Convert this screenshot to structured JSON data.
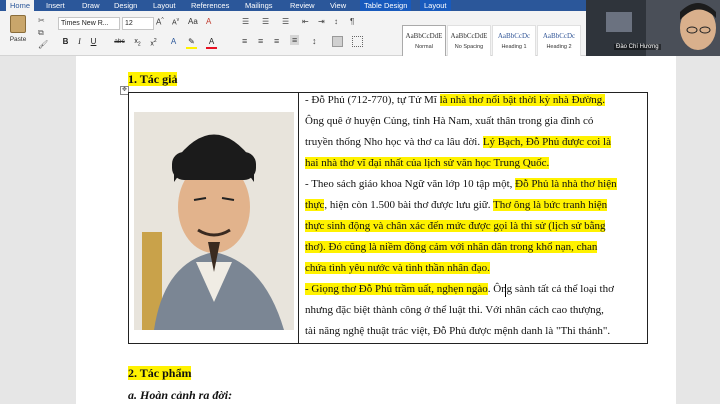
{
  "tabs": [
    "Home",
    "Insert",
    "Draw",
    "Design",
    "Layout",
    "References",
    "Mailings",
    "Review",
    "View",
    "Table Design",
    "Layout"
  ],
  "ribbon": {
    "paste_label": "Paste",
    "font_name": "Times New R...",
    "font_size": "12",
    "styles": [
      {
        "preview": "AaBbCcDdE",
        "name": "Normal"
      },
      {
        "preview": "AaBbCcDdE",
        "name": "No Spacing"
      },
      {
        "preview": "AaBbCcDc",
        "name": "Heading 1"
      },
      {
        "preview": "AaBbCcDc",
        "name": "Heading 2"
      }
    ]
  },
  "video": {
    "participant_name": "Đào Chí Hương"
  },
  "document": {
    "heading1": "1. Tác giả",
    "heading2": "2. Tác phẩm",
    "heading3": "a. Hoàn cảnh ra đời:",
    "lines": [
      [
        "- Đỗ Phủ (712-770), tự Tử Mĩ ",
        "là nhà thơ nổi bật thời kỳ nhà Đường."
      ],
      [
        "Ông quê ở huyện Củng, tỉnh Hà Nam, xuất thân trong gia đình có",
        ""
      ],
      [
        "truyền thống Nho học và thơ ca lâu đời. ",
        "Lý Bạch, Đỗ Phủ được coi là"
      ],
      [
        "",
        "hai nhà thơ vĩ đại nhất của lịch sử văn học Trung Quốc."
      ],
      [
        "- Theo sách giáo khoa Ngữ văn lớp 10 tập một, ",
        "Đỗ Phủ là nhà thơ hiện"
      ],
      [
        "",
        "thực",
        ", hiện còn 1.500 bài thơ được lưu giữ. ",
        "Thơ ông là bức tranh hiện"
      ],
      [
        "",
        "thực sinh động và chân xác đến mức được gọi là thi sử (lịch sử bằng"
      ],
      [
        "",
        "thơ). Đó cũng là niềm đồng cảm với nhân dân trong khổ nạn, chan"
      ],
      [
        "",
        "chứa tình yêu nước và tình thần nhân đạo."
      ],
      [
        "",
        "- Giọng thơ Đỗ Phủ trầm uất, nghẹn ngào",
        ". Ông sành tất cả thể loại thơ"
      ],
      [
        "nhưng đặc biệt thành công ở thể luật thi. Với nhân cách cao thượng,",
        ""
      ],
      [
        "tài năng nghệ thuật trác việt, Đỗ Phủ được mệnh danh là \"Thi thánh\".",
        ""
      ]
    ]
  }
}
